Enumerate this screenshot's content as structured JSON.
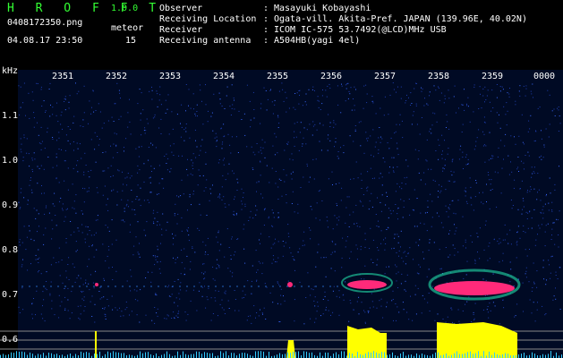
{
  "app": {
    "title": "H R O F F T",
    "version": "1.0.0"
  },
  "file": {
    "name": "0408172350.png",
    "date": "04.08.17 23:50"
  },
  "meteor": {
    "label": "meteor",
    "count": "15"
  },
  "info": [
    {
      "key": "Observer",
      "value": "Masayuki Kobayashi"
    },
    {
      "key": "Receiving Location",
      "value": "Ogata-vill. Akita-Pref. JAPAN (139.96E, 40.02N)"
    },
    {
      "key": "Receiver",
      "value": "ICOM IC-575 53.7492(@LCD)MHz USB"
    },
    {
      "key": "Receiving antenna",
      "value": "A504HB(yagi 4el)"
    }
  ],
  "axis": {
    "unit": "kHz",
    "y_ticks": [
      "1.1",
      "1.0",
      "0.9",
      "0.8",
      "0.7",
      "0.6"
    ],
    "x_ticks": [
      "2351",
      "2352",
      "2353",
      "2354",
      "2355",
      "2356",
      "2357",
      "2358",
      "2359",
      "0000"
    ]
  },
  "colors": {
    "green": "#33ff33",
    "background": "#000a24",
    "echo": "#ff2a7a",
    "level": "#ffff00"
  }
}
